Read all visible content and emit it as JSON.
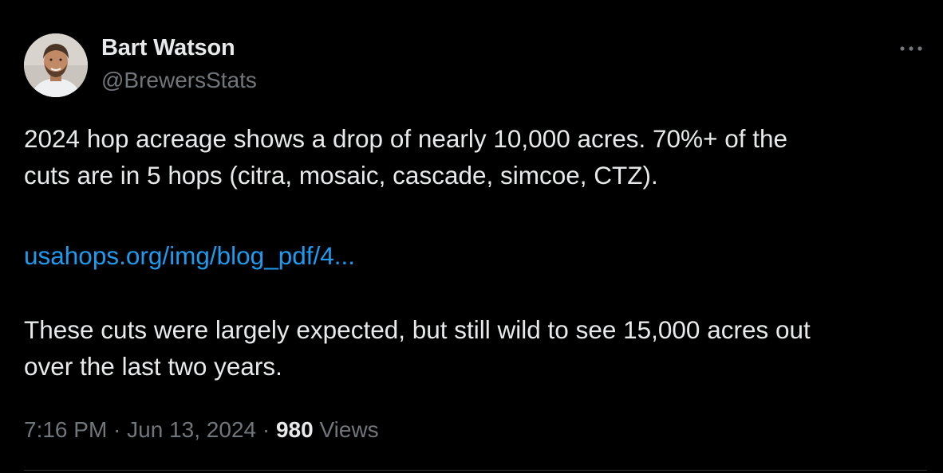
{
  "author": {
    "name": "Bart Watson",
    "handle": "@BrewersStats"
  },
  "more_icon": "more-horizontal-icon",
  "tweet": {
    "line1": "2024 hop acreage shows a drop of nearly 10,000 acres. 70%+ of the",
    "line2": "cuts are in 5 hops (citra, mosaic, cascade, simcoe, CTZ).",
    "link_text": "usahops.org/img/blog_pdf/4...",
    "line3": "These cuts were largely expected, but still wild to see 15,000 acres out",
    "line4": "over the last two years."
  },
  "meta": {
    "time": "7:16 PM",
    "separator": " · ",
    "date": "Jun 13, 2024",
    "views_count": "980",
    "views_label": " Views"
  },
  "colors": {
    "background": "#000000",
    "text": "#e7e9ea",
    "secondary": "#71767b",
    "link": "#1d9bf0"
  }
}
